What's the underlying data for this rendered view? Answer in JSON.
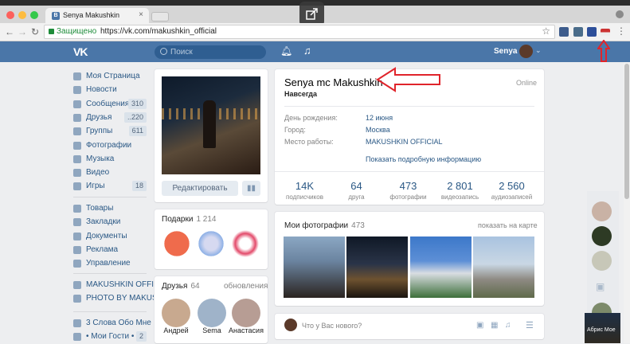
{
  "browser": {
    "tab_title": "Senya Makushkin",
    "secure_label": "Защищено",
    "url": "https://vk.com/makushkin_official"
  },
  "vk_header": {
    "logo": "VK",
    "search_placeholder": "Поиск",
    "username": "Senya"
  },
  "left_nav": {
    "items": [
      {
        "label": "Моя Страница",
        "icon": "user-icon"
      },
      {
        "label": "Новости",
        "icon": "news-icon"
      },
      {
        "label": "Сообщения",
        "icon": "messages-icon",
        "badge": "310"
      },
      {
        "label": "Друзья",
        "icon": "friends-icon",
        "badge": "..220"
      },
      {
        "label": "Группы",
        "icon": "groups-icon",
        "badge": "611"
      },
      {
        "label": "Фотографии",
        "icon": "camera-icon"
      },
      {
        "label": "Музыка",
        "icon": "music-icon"
      },
      {
        "label": "Видео",
        "icon": "video-icon"
      },
      {
        "label": "Игры",
        "icon": "games-icon",
        "badge": "18"
      }
    ],
    "items2": [
      {
        "label": "Товары",
        "icon": "goods-icon"
      },
      {
        "label": "Закладки",
        "icon": "star-icon"
      },
      {
        "label": "Документы",
        "icon": "docs-icon"
      },
      {
        "label": "Реклама",
        "icon": "ads-icon"
      },
      {
        "label": "Управление",
        "icon": "manage-icon"
      }
    ],
    "items3": [
      {
        "label": "MAKUSHKIN OFFI...",
        "icon": "group-icon"
      },
      {
        "label": "PHOTO BY MAKUS...",
        "icon": "group-icon"
      }
    ],
    "items4": [
      {
        "label": "3 Слова Обо Мне",
        "icon": "app-icon"
      },
      {
        "label": "• Мои Гости •",
        "icon": "app-icon",
        "badge": "2"
      }
    ]
  },
  "profile_card": {
    "edit_button": "Редактировать"
  },
  "gifts": {
    "title": "Подарки",
    "count": "1 214"
  },
  "friends": {
    "title": "Друзья",
    "count": "64",
    "updates": "обновления",
    "names": [
      "Андрей",
      "Sema",
      "Анастасия"
    ]
  },
  "profile": {
    "name": "Senya mc Makushkin",
    "status": "Навсегда",
    "online": "Online",
    "rows": [
      {
        "label": "День рождения:",
        "value": "12 июня"
      },
      {
        "label": "Город:",
        "value": "Москва"
      },
      {
        "label": "Место работы:",
        "value": "MAKUSHKIN OFFICIAL"
      }
    ],
    "more_info": "Показать подробную информацию"
  },
  "counters": [
    {
      "number": "14K",
      "label": "подписчиков"
    },
    {
      "number": "64",
      "label": "друга"
    },
    {
      "number": "473",
      "label": "фотографии"
    },
    {
      "number": "2 801",
      "label": "видеозапись"
    },
    {
      "number": "2 560",
      "label": "аудиозаписей"
    }
  ],
  "photos": {
    "title": "Мои фотографии",
    "count": "473",
    "map_link": "показать на карте"
  },
  "post_box": {
    "placeholder": "Что у Вас нового?"
  },
  "overlay": {
    "thumb_text": "Абрис Мое"
  },
  "colors": {
    "vk_blue": "#4a76a8",
    "link": "#2a5885",
    "arrow": "#e0242b"
  }
}
